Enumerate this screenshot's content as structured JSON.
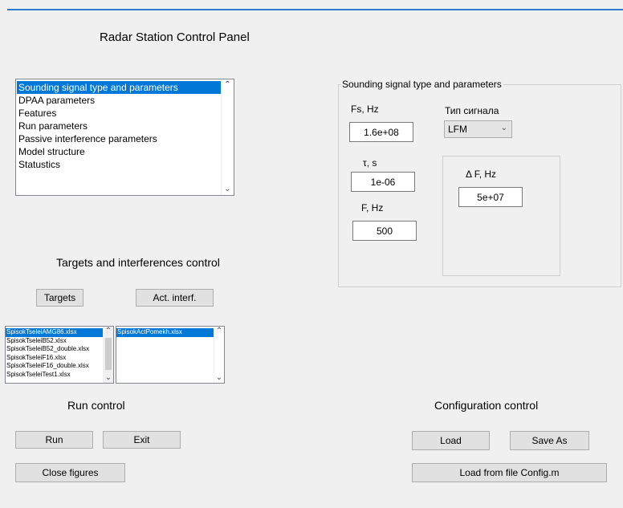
{
  "title": "Radar Station Control Panel",
  "menu_list": {
    "items": [
      "Sounding signal type and parameters",
      "DPAA parameters",
      "Features",
      "Run parameters",
      "Passive interference parameters",
      "Model structure",
      "Statustics"
    ],
    "selected_index": 0
  },
  "targets_section": {
    "title": "Targets and interferences control",
    "targets_button": "Targets",
    "act_interf_button": "Act. interf.",
    "targets_list": [
      "SpisokTseleiAMG86.xlsx",
      "SpisokTseleiB52.xlsx",
      "SpisokTseleiB52_double.xlsx",
      "SpisokTseleiF16.xlsx",
      "SpisokTseleiF16_double.xlsx",
      "SpisokTseleiTest1.xlsx"
    ],
    "interf_list": [
      "SpisokActPomekh.xlsx"
    ]
  },
  "run_control": {
    "title": "Run control",
    "run_button": "Run",
    "exit_button": "Exit",
    "close_figures_button": "Close figures"
  },
  "config_control": {
    "title": "Configuration control",
    "load_button": "Load",
    "save_as_button": "Save As",
    "load_config_button": "Load from file Config.m"
  },
  "signal_panel": {
    "title": "Sounding signal type and parameters",
    "fs_label": "Fs, Hz",
    "fs_value": "1.6e+08",
    "signal_type_label": "Тип сигнала",
    "signal_type_value": "LFM",
    "tau_label": "τ,  s",
    "tau_value": "1e-06",
    "f_label": "F, Hz",
    "f_value": "500",
    "delta_f_label": "Δ F, Hz",
    "delta_f_value": "5e+07"
  }
}
